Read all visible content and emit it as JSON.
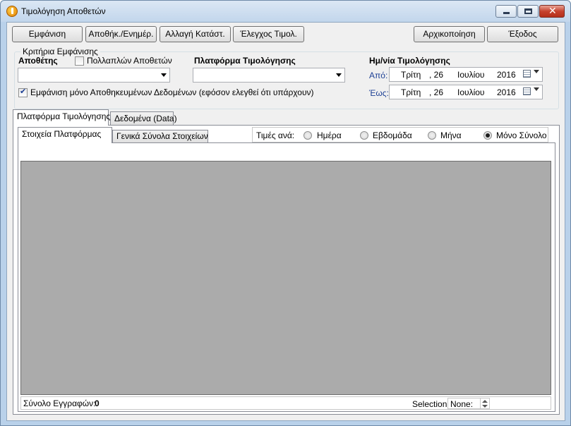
{
  "window": {
    "title": "Τιμολόγηση Αποθετών"
  },
  "toolbar": {
    "show_label": "Εμφάνιση",
    "save_label": "Αποθήκ./Ενημέρ.",
    "change_status_label": "Αλλαγή Κατάστ.",
    "check_invoice_label": "Έλεγχος Τιμολ.",
    "reset_label": "Αρχικοποίηση",
    "exit_label": "Έξοδος"
  },
  "criteria": {
    "group_label": "Κριτήρια Εμφάνισης",
    "depositor_label": "Αποθέτης",
    "multiple_depositors_label": "Πολλαπλών Αποθετών",
    "multiple_depositors_checked": false,
    "depositor_value": "",
    "platform_label": "Πλατφόρμα Τιμολόγησης",
    "platform_value": "",
    "saved_only_label": "Εμφάνιση μόνο Αποθηκευμένων Δεδομένων (εφόσον ελεγθεί ότι υπάρχουν)",
    "saved_only_checked": true,
    "date_label": "Ημ/νία Τιμολόγησης",
    "from_label": "Από:",
    "to_label": "Έως:",
    "from_date": {
      "weekday": "Τρίτη",
      "day": ", 26",
      "month": "Ιουλίου",
      "year": "2016"
    },
    "to_date": {
      "weekday": "Τρίτη",
      "day": ", 26",
      "month": "Ιουλίου",
      "year": "2016"
    }
  },
  "tabs": {
    "outer": [
      {
        "label": "Πλατφόρμα Τιμολόγησης",
        "active": true
      },
      {
        "label": "Δεδομένα (Data)",
        "active": false
      }
    ],
    "inner": [
      {
        "label": "Στοιχεία Πλατφόρμας",
        "active": true
      },
      {
        "label": "Γενικά Σύνολα Στοιχείων",
        "active": false
      }
    ]
  },
  "values_by": {
    "label": "Τιμές ανά:",
    "options": [
      {
        "label": "Ημέρα",
        "checked": false
      },
      {
        "label": "Εβδομάδα",
        "checked": false
      },
      {
        "label": "Μήνα",
        "checked": false
      },
      {
        "label": "Μόνο Σύνολο",
        "checked": true
      }
    ]
  },
  "status": {
    "total_records_label": "Σύνολο Εγγραφών:",
    "total_records_value": "0",
    "selection_label": "Selection",
    "selection_value": "None:"
  },
  "colors": {
    "grid_background": "#ababab",
    "link_blue": "#1c3f94",
    "client_background": "#f0f0f0"
  }
}
